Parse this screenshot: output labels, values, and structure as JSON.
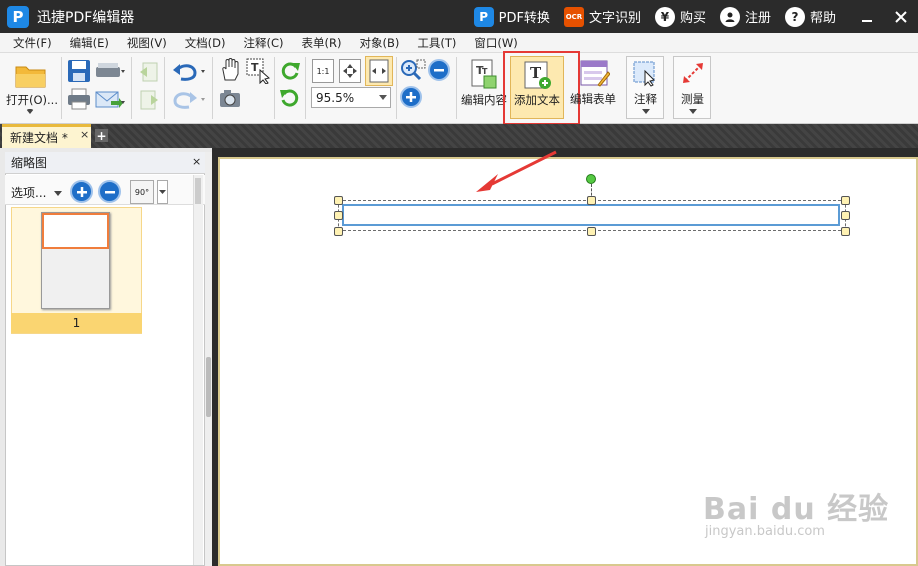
{
  "app": {
    "title": "迅捷PDF编辑器",
    "logo": "P"
  },
  "titlebar_right": {
    "pdf_convert": "PDF转换",
    "ocr": "文字识别",
    "buy": "购买",
    "register": "注册",
    "help": "帮助",
    "ocr_badge": "OCR",
    "buy_icon": "¥",
    "help_icon": "?"
  },
  "menu": [
    "文件(F)",
    "编辑(E)",
    "视图(V)",
    "文档(D)",
    "注释(C)",
    "表单(R)",
    "对象(B)",
    "工具(T)",
    "窗口(W)"
  ],
  "toolbar": {
    "open": "打开(O)...",
    "zoom": "95.5%",
    "edit_content": "编辑内容",
    "add_text": "添加文本",
    "edit_form": "编辑表单",
    "annotate": "注释",
    "measure": "测量",
    "fit_actual": "1:1"
  },
  "tab": {
    "label": "新建文档 *",
    "close": "×",
    "add": "+"
  },
  "panel": {
    "title": "缩略图",
    "close": "×",
    "options": "选项...",
    "rotate": "90°",
    "thumbnail_page": "1"
  },
  "watermark": {
    "main": "Bai du 经验",
    "sub": "jingyan.baidu.com"
  },
  "colors": {
    "accent": "#1e88e5",
    "highlight": "#fde9b0",
    "annotation_frame": "#e53935",
    "arrow": "#e53935"
  }
}
